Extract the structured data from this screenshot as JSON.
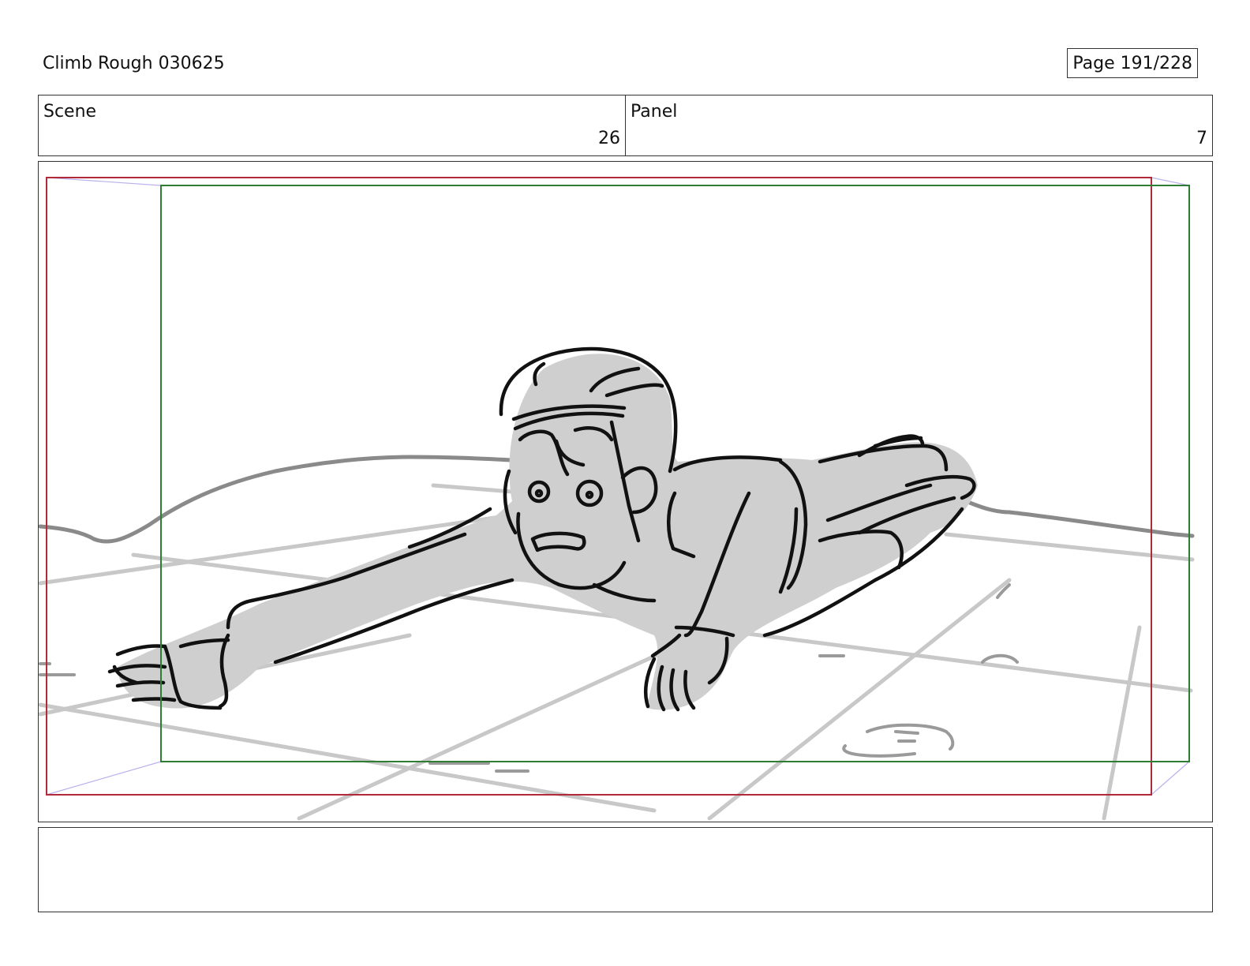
{
  "header": {
    "title": "Climb Rough 030625",
    "page_label": "Page 191/228"
  },
  "info": {
    "scene_label": "Scene",
    "scene_value": "26",
    "panel_label": "Panel",
    "panel_value": "7"
  },
  "panel": {
    "frame_colors": {
      "safe_area": "#b22a3a",
      "camera_frame": "#2e7d32",
      "perspective_guides": "#b9b3ee"
    }
  },
  "notes": {
    "text": ""
  }
}
